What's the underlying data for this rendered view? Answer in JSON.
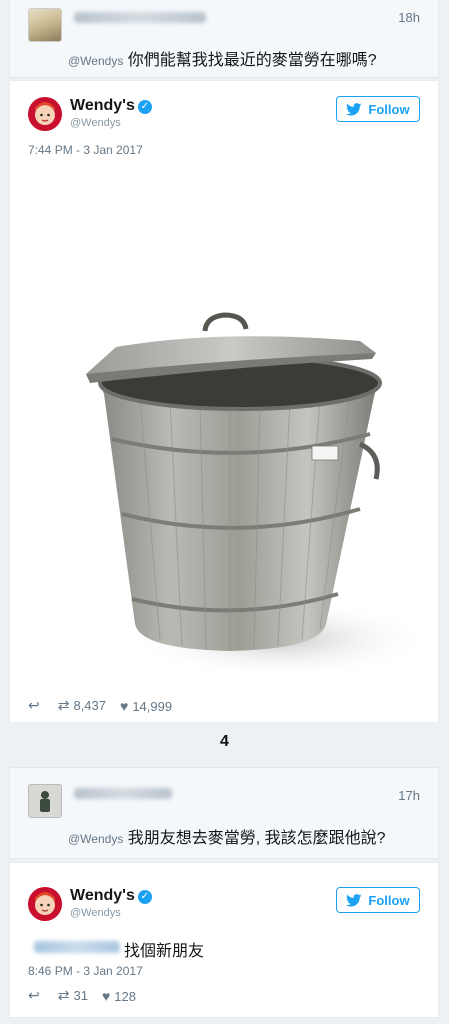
{
  "tweet1": {
    "time": "18h",
    "mention": "@Wendys",
    "question": "你們能幫我找最近的麥當勞在哪嗎?"
  },
  "reply1": {
    "name": "Wendy's",
    "handle": "@Wendys",
    "follow_label": "Follow",
    "timestamp": "7:44 PM - 3 Jan 2017",
    "retweets": "8,437",
    "likes": "14,999"
  },
  "divider_number": "4",
  "tweet2": {
    "time": "17h",
    "mention": "@Wendys",
    "question": "我朋友想去麥當勞, 我該怎麼跟他說?"
  },
  "reply2": {
    "name": "Wendy's",
    "handle": "@Wendys",
    "follow_label": "Follow",
    "answer": "找個新朋友",
    "timestamp": "8:46 PM - 3 Jan 2017",
    "retweets": "31",
    "likes": "128"
  },
  "icons": [
    "reply-icon",
    "retweet-icon",
    "heart-icon",
    "twitter-bird-icon",
    "verified-badge-icon"
  ],
  "colors": {
    "accent": "#1da1f2",
    "wendys_red": "#c8102e"
  }
}
